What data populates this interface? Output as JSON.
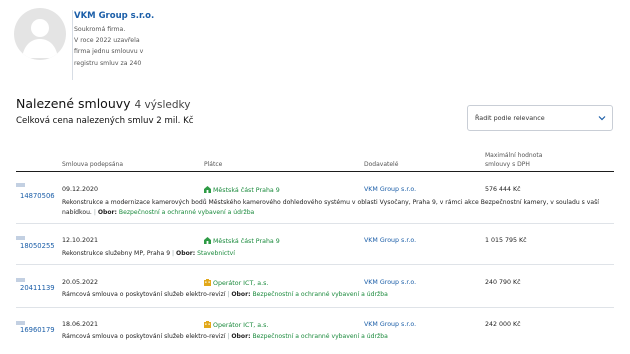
{
  "company": {
    "name": "VKM Group s.r.o.",
    "desc_lines": [
      "Soukromá firma.",
      "V roce 2022 uzavřela",
      "firma jednu smlouvu v",
      "registru smluv za 240"
    ]
  },
  "results": {
    "title": "Nalezené smlouvy",
    "count": "4 výsledky",
    "total": "Celková cena nalezených smluv 2 mil. Kč"
  },
  "sort": {
    "label": "Řadit podle relevance"
  },
  "table": {
    "headers": {
      "date": "Smlouva podepsána",
      "supplier": "Plátce",
      "vendor": "Dodavatelé",
      "amount_line1": "Maximální hodnota",
      "amount_line2": "smlouvy s DPH"
    },
    "rows": [
      {
        "id": "14870506",
        "date": "09.12.2020",
        "supplier": "Městská část Praha 9",
        "supplier_type": "municipality",
        "vendor": "VKM Group s.r.o.",
        "amount": "576 444 Kč",
        "desc": "Rekonstrukce a modernizace kamerových bodů Městského kamerového dohledového systému v oblasti Vysočany, Praha 9, v rámci akce Bezpečnostní kamery, v souladu s vaší",
        "desc2": "nabídkou.",
        "field_label": "Obor:",
        "field": "Bezpečnostní a ochranné vybavení a údržba"
      },
      {
        "id": "18050255",
        "date": "12.10.2021",
        "supplier": "Městská část Praha 9",
        "supplier_type": "municipality",
        "vendor": "VKM Group s.r.o.",
        "amount": "1 015 795 Kč",
        "desc": "Rekonstrukce služebny MP, Praha 9",
        "field_label": "Obor:",
        "field": "Stavebnictví"
      },
      {
        "id": "20411139",
        "date": "20.05.2022",
        "supplier": "Operátor ICT, a.s.",
        "supplier_type": "company",
        "vendor": "VKM Group s.r.o.",
        "amount": "240 790 Kč",
        "desc": "Rámcová smlouva o poskytování služeb elektro-revizí",
        "field_label": "Obor:",
        "field": "Bezpečnostní a ochranné vybavení a údržba"
      },
      {
        "id": "16960179",
        "date": "18.06.2021",
        "supplier": "Operátor ICT, a.s.",
        "supplier_type": "company",
        "vendor": "VKM Group s.r.o.",
        "amount": "242 000 Kč",
        "desc": "Rámcová smlouva o poskytování služeb elektro-revizí",
        "field_label": "Obor:",
        "field": "Bezpečnostní a ochranné vybavení a údržba"
      }
    ]
  },
  "colors": {
    "link_blue": "#1b5ea8",
    "link_green": "#1a8a3c",
    "municipality_icon": "#2e9b45",
    "company_icon": "#e2a81a"
  },
  "icons": {
    "municipality": "building-icon",
    "company": "company-icon",
    "avatar": "person-avatar-icon",
    "sort": "chevron-down-icon"
  }
}
